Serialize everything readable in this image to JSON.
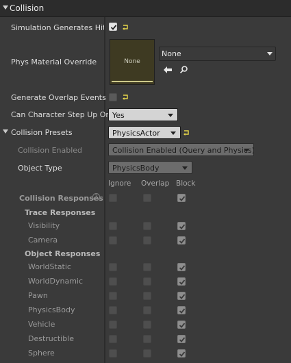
{
  "section": {
    "title": "Collision"
  },
  "props": {
    "sim_hit": "Simulation Generates Hit Events",
    "phys_mat": "Phys Material Override",
    "overlap": "Generate Overlap Events",
    "step_up": "Can Character Step Up On",
    "presets": "Collision Presets",
    "coll_enabled": "Collision Enabled",
    "object_type": "Object Type",
    "coll_responses": "Collision Responses"
  },
  "values": {
    "mat_thumb": "None",
    "mat_combo": "None",
    "step_up": "Yes",
    "presets": "PhysicsActor",
    "coll_enabled": "Collision Enabled (Query and Physics)",
    "object_type": "PhysicsBody"
  },
  "columns": {
    "ignore": "Ignore",
    "overlap": "Overlap",
    "block": "Block"
  },
  "groups": {
    "trace": "Trace Responses",
    "object": "Object Responses"
  },
  "help_glyph": "?",
  "responses": [
    {
      "label": "Visibility",
      "ignore": false,
      "overlap": false,
      "block": true
    },
    {
      "label": "Camera",
      "ignore": false,
      "overlap": false,
      "block": true
    },
    {
      "label": "WorldStatic",
      "ignore": false,
      "overlap": false,
      "block": true
    },
    {
      "label": "WorldDynamic",
      "ignore": false,
      "overlap": false,
      "block": true
    },
    {
      "label": "Pawn",
      "ignore": false,
      "overlap": false,
      "block": true
    },
    {
      "label": "PhysicsBody",
      "ignore": false,
      "overlap": false,
      "block": true
    },
    {
      "label": "Vehicle",
      "ignore": false,
      "overlap": false,
      "block": true
    },
    {
      "label": "Destructible",
      "ignore": false,
      "overlap": false,
      "block": true
    },
    {
      "label": "Sphere",
      "ignore": false,
      "overlap": false,
      "block": true
    }
  ],
  "checks": {
    "sim_hit": true,
    "overlap_events": false,
    "all_block": true,
    "all_ignore": false,
    "all_overlap": false
  },
  "colors": {
    "panel": "#3a3a3a",
    "header": "#2c2c2c",
    "reset_arrow": "#e8d84a",
    "thumb": "#3e3a22"
  }
}
